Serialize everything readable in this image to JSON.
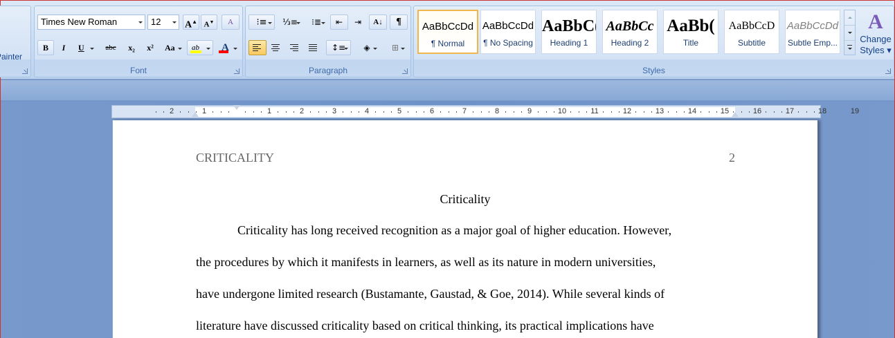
{
  "ribbon": {
    "clipboard": {
      "painter_label": "Painter"
    },
    "font": {
      "group_label": "Font",
      "font_name": "Times New Roman",
      "font_size": "12",
      "grow_label": "A",
      "shrink_label": "A",
      "clear_format_label": "A",
      "bold": "B",
      "italic": "I",
      "underline": "U",
      "strikethrough": "abc",
      "subscript": "x₂",
      "superscript": "x²",
      "change_case": "Aa",
      "highlight": "ab",
      "font_color": "A"
    },
    "paragraph": {
      "group_label": "Paragraph",
      "show_marks": "¶"
    },
    "styles": {
      "group_label": "Styles",
      "items": [
        {
          "sample": "AaBbCcDd",
          "name": "¶ Normal"
        },
        {
          "sample": "AaBbCcDd",
          "name": "¶ No Spacing"
        },
        {
          "sample": "AaBbC(",
          "name": "Heading 1"
        },
        {
          "sample": "AaBbCc",
          "name": "Heading 2"
        },
        {
          "sample": "AaBb(",
          "name": "Title"
        },
        {
          "sample": "AaBbCcD",
          "name": "Subtitle"
        },
        {
          "sample": "AaBbCcDd",
          "name": "Subtle Emp..."
        }
      ],
      "change_styles_line1": "Change",
      "change_styles_line2": "Styles"
    }
  },
  "ruler": {
    "left_numbers": [
      "2",
      "1"
    ],
    "right_numbers": [
      "1",
      "2",
      "3",
      "4",
      "5",
      "6",
      "7",
      "8",
      "9",
      "10",
      "11",
      "12",
      "13",
      "14",
      "15",
      "16",
      "17",
      "18",
      "19"
    ]
  },
  "document": {
    "header_left": "CRITICALITY",
    "page_number": "2",
    "title": "Criticality",
    "lines": [
      "Criticality has long received recognition as a major goal of higher education. However,",
      "the procedures by which it manifests in learners, as well as its nature in modern universities,",
      "have undergone limited research (Bustamante, Gaustad, & Goe, 2014). While several kinds of",
      "literature have discussed criticality based on critical thinking, its practical implications have"
    ]
  }
}
